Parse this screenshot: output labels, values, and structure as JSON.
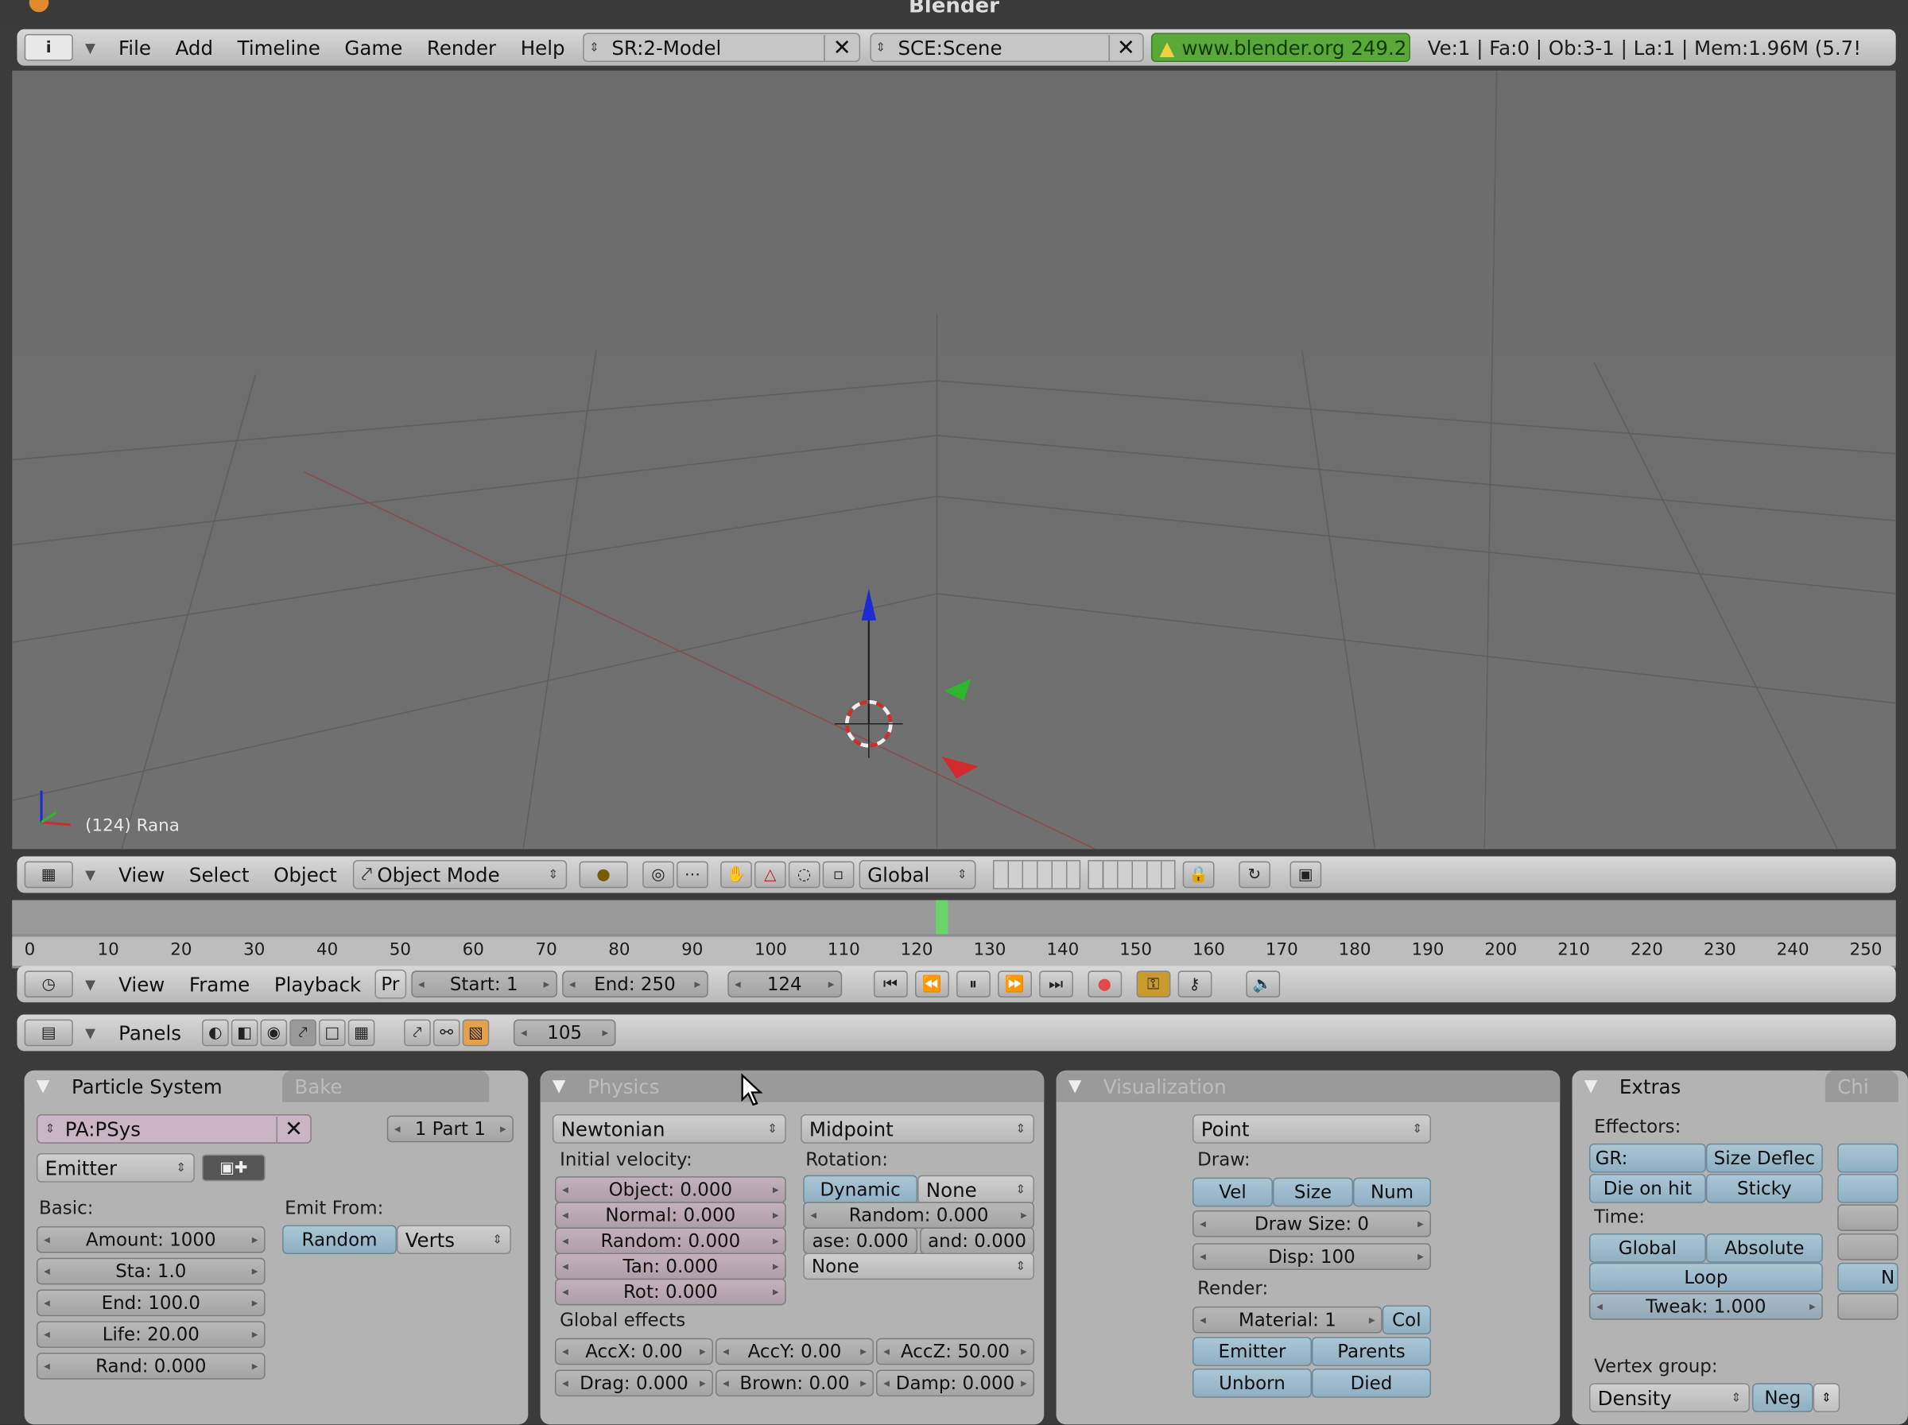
{
  "window_title": "Blender",
  "top_header": {
    "menus": [
      "File",
      "Add",
      "Timeline",
      "Game",
      "Render",
      "Help"
    ],
    "screen_field": "SR:2-Model",
    "scene_field": "SCE:Scene",
    "website": "www.blender.org 249.2",
    "stats": "Ve:1 | Fa:0 | Ob:3-1 | La:1  | Mem:1.96M (5.7!"
  },
  "viewport": {
    "object_label": "(124) Rana"
  },
  "view3d_header": {
    "menus": [
      "View",
      "Select",
      "Object"
    ],
    "mode": "Object Mode",
    "orientation": "Global"
  },
  "timeline": {
    "ticks": [
      "0",
      "10",
      "20",
      "30",
      "40",
      "50",
      "60",
      "70",
      "80",
      "90",
      "100",
      "110",
      "120",
      "130",
      "140",
      "150",
      "160",
      "170",
      "180",
      "190",
      "200",
      "210",
      "220",
      "230",
      "240",
      "250"
    ],
    "current_frame_fraction": 0.496,
    "menus": [
      "View",
      "Frame",
      "Playback"
    ],
    "pr_label": "Pr",
    "start": "Start: 1",
    "end": "End: 250",
    "current": "124"
  },
  "buttons_header": {
    "menu": "Panels",
    "frame_value": "105"
  },
  "particle_panel": {
    "tab_active": "Particle System",
    "tab_inactive": "Bake",
    "psys_name": "PA:PSys",
    "part_selector": "1 Part 1",
    "type": "Emitter",
    "basic_label": "Basic:",
    "amount": "Amount: 1000",
    "sta": "Sta: 1.0",
    "end": "End: 100.0",
    "life": "Life: 20.00",
    "rand": "Rand: 0.000",
    "emit_from_label": "Emit From:",
    "emit_random": "Random",
    "emit_verts": "Verts"
  },
  "physics_panel": {
    "tab": "Physics",
    "physics_type": "Newtonian",
    "integrator": "Midpoint",
    "initial_velocity_label": "Initial velocity:",
    "object": "Object: 0.000",
    "normal": "Normal: 0.000",
    "random": "Random: 0.000",
    "tan": "Tan: 0.000",
    "rot": "Rot: 0.000",
    "rotation_label": "Rotation:",
    "dynamic": "Dynamic",
    "rotation_mode": "None",
    "rot_random": "Random: 0.000",
    "phase": "ase: 0.000",
    "rand_phase": "and: 0.000",
    "angular": "None",
    "global_effects_label": "Global effects",
    "accx": "AccX: 0.00",
    "accy": "AccY: 0.00",
    "accz": "AccZ: 50.00",
    "drag": "Drag: 0.000",
    "brown": "Brown: 0.00",
    "damp": "Damp: 0.000"
  },
  "visualization_panel": {
    "tab": "Visualization",
    "draw_type": "Point",
    "draw_label": "Draw:",
    "vel": "Vel",
    "size": "Size",
    "num": "Num",
    "draw_size": "Draw Size: 0",
    "disp": "Disp: 100",
    "render_label": "Render:",
    "material": "Material: 1",
    "col": "Col",
    "emitter": "Emitter",
    "parents": "Parents",
    "unborn": "Unborn",
    "died": "Died"
  },
  "extras_panel": {
    "tab": "Extras",
    "tab2": "Chi",
    "effectors_label": "Effectors:",
    "gr": "GR:",
    "size_deflect": "Size Deflec",
    "die_on_hit": "Die on hit",
    "sticky": "Sticky",
    "time_label": "Time:",
    "global": "Global",
    "absolute": "Absolute",
    "loop": "Loop",
    "tweak": "Tweak: 1.000",
    "vertex_group_label": "Vertex group:",
    "vgroup": "Density",
    "neg": "Neg",
    "cut_n": "N"
  },
  "colors": {
    "viewport_bg": "#6e6e6e",
    "header_bg": "#c8c8c8",
    "panel_bg": "#b3b3b3",
    "blue_button": "#9dbccd",
    "website_green": "#5aa839",
    "axis_z": "#1d2bd6",
    "axis_y": "#2eb52e",
    "axis_x": "#d22b2b",
    "timeline_marker": "#6ad46a"
  }
}
